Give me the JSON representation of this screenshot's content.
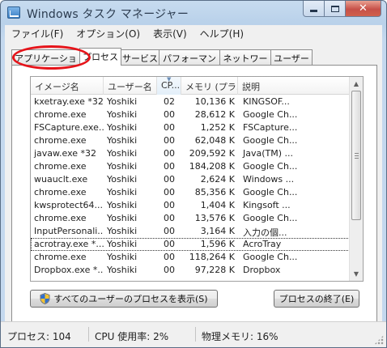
{
  "window": {
    "title": "Windows タスク マネージャー",
    "caption_buttons": [
      "minimize",
      "maximize",
      "close"
    ],
    "close_glyph": "✕"
  },
  "menu": [
    "ファイル(F)",
    "オプション(O)",
    "表示(V)",
    "ヘルプ(H)"
  ],
  "tabs": [
    "アプリケーション",
    "プロセス",
    "サービス",
    "パフォーマンス",
    "ネットワーク",
    "ユーザー"
  ],
  "active_tab": "アプリケーション",
  "annotation": {
    "color": "#e6141a",
    "target": "アプリケーション"
  },
  "columns": [
    "イメージ名",
    "ユーザー名",
    "CP...",
    "メモリ (プラ...",
    "説明"
  ],
  "processes": [
    {
      "name": "kxetray.exe *32",
      "user": "Yoshiki",
      "cpu": "02",
      "mem": "10,136 K",
      "desc": "KINGSOF..."
    },
    {
      "name": "chrome.exe",
      "user": "Yoshiki",
      "cpu": "00",
      "mem": "28,612 K",
      "desc": "Google Ch..."
    },
    {
      "name": "FSCapture.exe...",
      "user": "Yoshiki",
      "cpu": "00",
      "mem": "1,252 K",
      "desc": "FSCapture..."
    },
    {
      "name": "chrome.exe",
      "user": "Yoshiki",
      "cpu": "00",
      "mem": "62,048 K",
      "desc": "Google Ch..."
    },
    {
      "name": "javaw.exe *32",
      "user": "Yoshiki",
      "cpu": "00",
      "mem": "209,592 K",
      "desc": "Java(TM) ..."
    },
    {
      "name": "chrome.exe",
      "user": "Yoshiki",
      "cpu": "00",
      "mem": "184,208 K",
      "desc": "Google Ch..."
    },
    {
      "name": "wuauclt.exe",
      "user": "Yoshiki",
      "cpu": "00",
      "mem": "2,624 K",
      "desc": "Windows ..."
    },
    {
      "name": "chrome.exe",
      "user": "Yoshiki",
      "cpu": "00",
      "mem": "85,356 K",
      "desc": "Google Ch..."
    },
    {
      "name": "kwsprotect64....",
      "user": "Yoshiki",
      "cpu": "00",
      "mem": "1,404 K",
      "desc": "Kingsoft ..."
    },
    {
      "name": "chrome.exe",
      "user": "Yoshiki",
      "cpu": "00",
      "mem": "13,576 K",
      "desc": "Google Ch..."
    },
    {
      "name": "InputPersonali...",
      "user": "Yoshiki",
      "cpu": "00",
      "mem": "3,164 K",
      "desc": "入力の個..."
    },
    {
      "name": "acrotray.exe *...",
      "user": "Yoshiki",
      "cpu": "00",
      "mem": "1,596 K",
      "desc": "AcroTray",
      "selected": true
    },
    {
      "name": "chrome.exe",
      "user": "Yoshiki",
      "cpu": "00",
      "mem": "118,264 K",
      "desc": "Google Ch..."
    },
    {
      "name": "Dropbox.exe *...",
      "user": "Yoshiki",
      "cpu": "00",
      "mem": "97,228 K",
      "desc": "Dropbox"
    }
  ],
  "buttons": {
    "show_all": "すべてのユーザーのプロセスを表示(S)",
    "end_process": "プロセスの終了(E)"
  },
  "status": {
    "processes": "プロセス: 104",
    "cpu": "CPU 使用率: 2%",
    "memory": "物理メモリ: 16%"
  },
  "icons": {
    "shield": "uac-shield-icon",
    "app": "task-manager-icon"
  }
}
